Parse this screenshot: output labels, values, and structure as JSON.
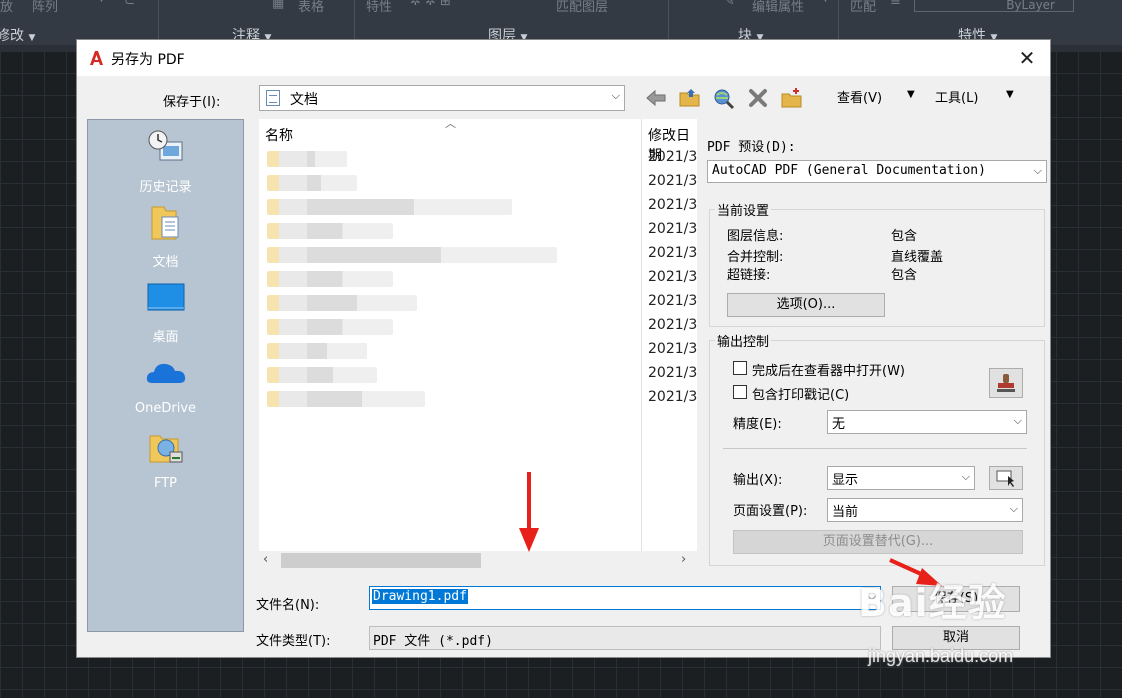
{
  "ribbon": {
    "top_items": [
      "放",
      "阵列",
      "表格",
      "特性",
      "匹配图层",
      "编辑属性",
      "匹配"
    ],
    "bylayer": "ByLayer",
    "groups": [
      "修改",
      "注释",
      "图层",
      "块",
      "特性"
    ]
  },
  "dialog": {
    "title": "另存为 PDF",
    "save_in_label": "保存于(I):",
    "save_in_value": "文档",
    "view_menu": "查看(V)",
    "tools_menu": "工具(L)",
    "places": [
      "历史记录",
      "文档",
      "桌面",
      "OneDrive",
      "FTP"
    ],
    "file_list": {
      "col_name": "名称",
      "col_date": "修改日期",
      "dates": [
        "2021/3",
        "2021/3",
        "2021/3",
        "2021/3",
        "2021/3",
        "2021/3",
        "2021/3",
        "2021/3",
        "2021/3",
        "2021/3",
        "2021/3"
      ]
    },
    "file_name_label": "文件名(N):",
    "file_name_value": "Drawing1.pdf",
    "file_type_label": "文件类型(T):",
    "file_type_value": "PDF 文件 (*.pdf)",
    "save_button": "保存(S)",
    "cancel_button": "取消"
  },
  "options": {
    "preset_label": "PDF 预设(D):",
    "preset_value": "AutoCAD PDF (General Documentation)",
    "current_settings_title": "当前设置",
    "current_settings": [
      {
        "key": "图层信息:",
        "value": "包含"
      },
      {
        "key": "合并控制:",
        "value": "直线覆盖"
      },
      {
        "key": "超链接:",
        "value": "包含"
      }
    ],
    "options_button": "选项(O)...",
    "output_control_title": "输出控制",
    "open_in_viewer": "完成后在查看器中打开(W)",
    "include_stamp": "包含打印戳记(C)",
    "precision_label": "精度(E):",
    "precision_value": "无",
    "output_label": "输出(X):",
    "output_value": "显示",
    "page_setup_label": "页面设置(P):",
    "page_setup_value": "当前",
    "page_override_button": "页面设置替代(G)..."
  },
  "watermark": {
    "brand": "Bai经验",
    "url": "jingyan.baidu.com"
  },
  "colors": {
    "accent": "#0078d7",
    "annotation": "#e8201a"
  }
}
